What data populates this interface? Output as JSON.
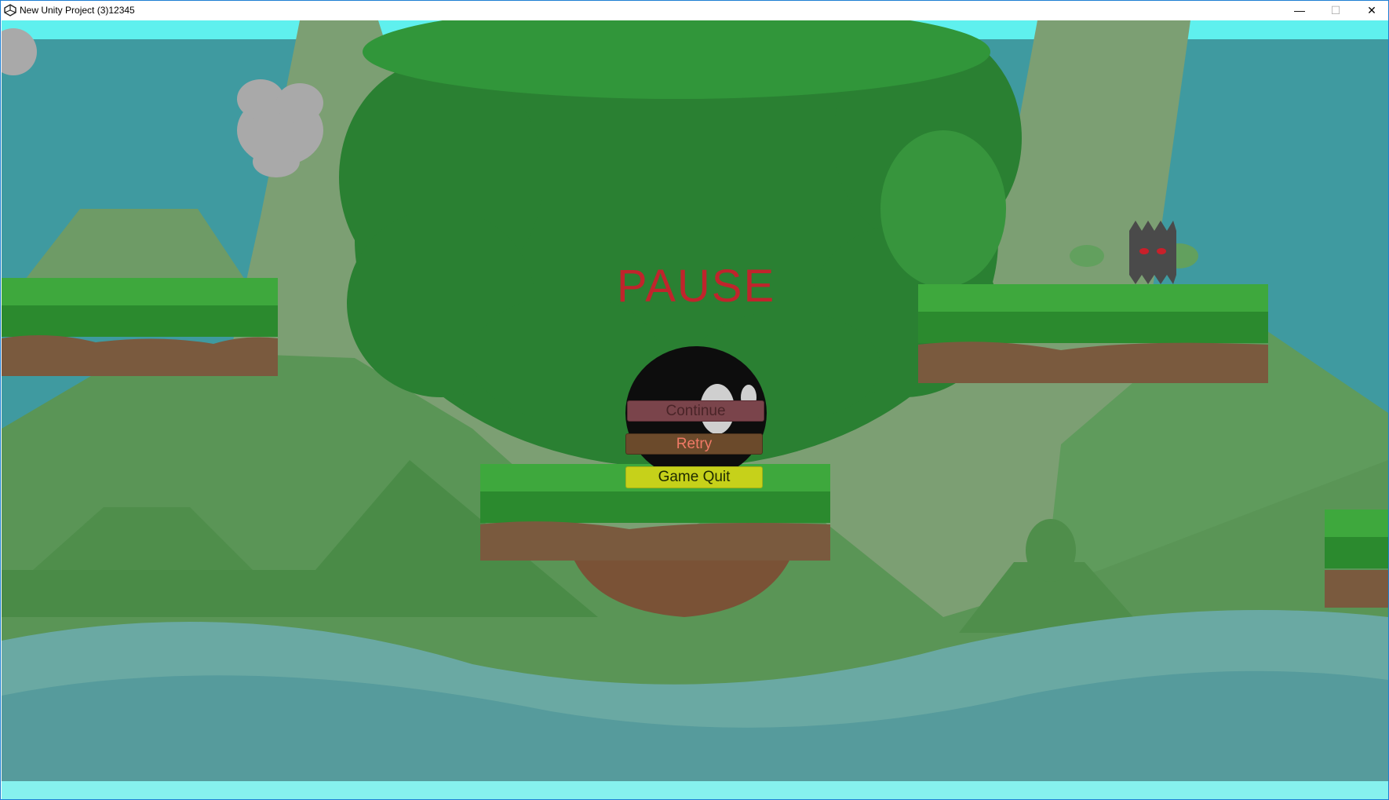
{
  "window": {
    "title": "New Unity Project (3)12345",
    "minimize_glyph": "—",
    "maximize_glyph": "☐",
    "close_glyph": "✕",
    "app_icon": "unity-icon"
  },
  "hud": {
    "pause_label": "PAUSE",
    "continue_label": "Continue",
    "retry_label": "Retry",
    "quit_label": "Game Quit"
  },
  "colors": {
    "sky": "#3f9aa0",
    "tree": "#2a8032",
    "water": "#5aa3a3",
    "pause_text": "#c0242c",
    "quit_button": "#c6d11a"
  }
}
